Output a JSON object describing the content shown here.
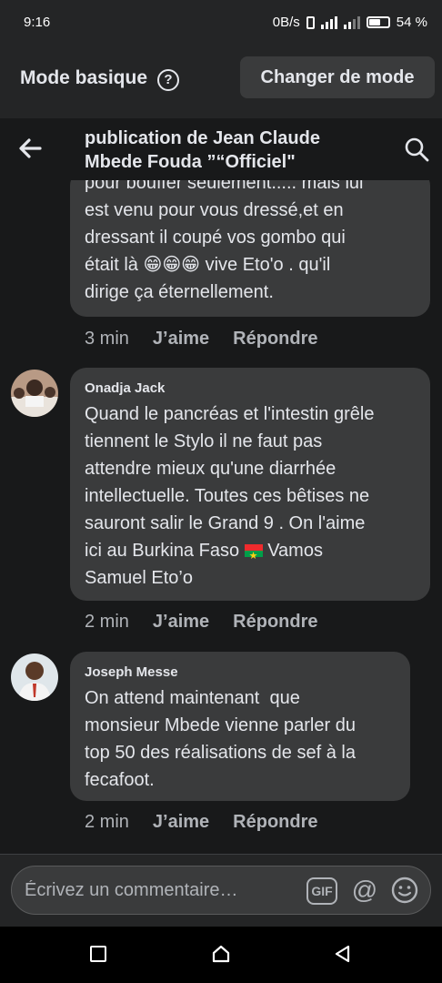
{
  "status_bar": {
    "time": "9:16",
    "network_speed": "0B/s",
    "battery_level": "54 %"
  },
  "mode_bar": {
    "title": "Mode basique",
    "help_icon": "question-circle-icon",
    "change_mode_label": "Changer de mode"
  },
  "nav": {
    "back_icon": "arrow-left-icon",
    "title": "publication de Jean Claude Mbede Fouda ”“Officiel\"",
    "search_icon": "search-icon"
  },
  "comments": [
    {
      "text": "pour bouffer seulement..... mais lui est venu pour vous dressé,et en dressant il coupé vos gombo qui était là 😁😁😁 vive Eto'o . qu'il dirige ça éternellement.",
      "line1": "pour bouffer seulement..... mais lui",
      "line2": "est venu pour vous dressé,et en",
      "line3": "dressant il coupé vos gombo qui",
      "line4": "était là 😁😁😁 vive Eto'o . qu'il",
      "line5": "dirige ça éternellement.",
      "time": "3 min",
      "like": "J’aime",
      "reply": "Répondre"
    },
    {
      "author": "Onadja Jack",
      "line1": "Quand le pancréas et l'intestin grêle",
      "line2": "tiennent le Stylo il ne faut pas",
      "line3": "attendre mieux qu'une diarrhée",
      "line4": "intellectuelle. Toutes ces bêtises ne",
      "line5": "sauront salir le Grand 9 . On l'aime",
      "line6a": "ici au Burkina Faso",
      "line6b": "Vamos",
      "line7": "Samuel Eto’o",
      "time": "2 min",
      "like": "J’aime",
      "reply": "Répondre"
    },
    {
      "author": "Joseph Messe",
      "line1": "On attend maintenant  que",
      "line2": "monsieur Mbede vienne parler du",
      "line3": "top 50 des réalisations de sef à la",
      "line4": "fecafoot.",
      "time": "2 min",
      "like": "J’aime",
      "reply": "Répondre"
    }
  ],
  "composer": {
    "placeholder": "Écrivez un commentaire…",
    "gif_label": "GIF",
    "at_label": "@"
  },
  "colors": {
    "background": "#18191a",
    "bar": "#242526",
    "bubble": "#3a3b3c",
    "text": "#e4e6eb",
    "muted": "#b0b3b8"
  }
}
